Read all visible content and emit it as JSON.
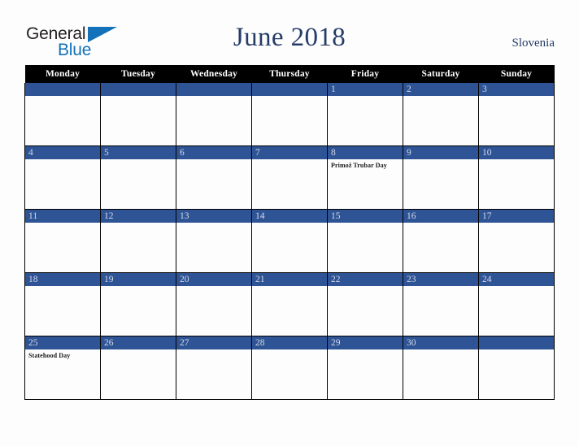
{
  "brand": {
    "line1": "General",
    "line2": "Blue",
    "triangle_icon": "triangle-icon",
    "color_dark": "#231f20",
    "color_blue": "#1271b8"
  },
  "header": {
    "title": "June 2018",
    "country": "Slovenia",
    "title_color": "#253c67"
  },
  "calendar": {
    "weekday_headers": [
      "Monday",
      "Tuesday",
      "Wednesday",
      "Thursday",
      "Friday",
      "Saturday",
      "Sunday"
    ],
    "header_bg": "#000000",
    "daybar_bg": "#2e5496",
    "daynum_color": "#d6dbe6",
    "weeks": [
      [
        {
          "num": "",
          "events": []
        },
        {
          "num": "",
          "events": []
        },
        {
          "num": "",
          "events": []
        },
        {
          "num": "",
          "events": []
        },
        {
          "num": "1",
          "events": []
        },
        {
          "num": "2",
          "events": []
        },
        {
          "num": "3",
          "events": []
        }
      ],
      [
        {
          "num": "4",
          "events": []
        },
        {
          "num": "5",
          "events": []
        },
        {
          "num": "6",
          "events": []
        },
        {
          "num": "7",
          "events": []
        },
        {
          "num": "8",
          "events": [
            "Primož Trubar Day"
          ]
        },
        {
          "num": "9",
          "events": []
        },
        {
          "num": "10",
          "events": []
        }
      ],
      [
        {
          "num": "11",
          "events": []
        },
        {
          "num": "12",
          "events": []
        },
        {
          "num": "13",
          "events": []
        },
        {
          "num": "14",
          "events": []
        },
        {
          "num": "15",
          "events": []
        },
        {
          "num": "16",
          "events": []
        },
        {
          "num": "17",
          "events": []
        }
      ],
      [
        {
          "num": "18",
          "events": []
        },
        {
          "num": "19",
          "events": []
        },
        {
          "num": "20",
          "events": []
        },
        {
          "num": "21",
          "events": []
        },
        {
          "num": "22",
          "events": []
        },
        {
          "num": "23",
          "events": []
        },
        {
          "num": "24",
          "events": []
        }
      ],
      [
        {
          "num": "25",
          "events": [
            "Statehood Day"
          ]
        },
        {
          "num": "26",
          "events": []
        },
        {
          "num": "27",
          "events": []
        },
        {
          "num": "28",
          "events": []
        },
        {
          "num": "29",
          "events": []
        },
        {
          "num": "30",
          "events": []
        },
        {
          "num": "",
          "events": []
        }
      ]
    ]
  }
}
